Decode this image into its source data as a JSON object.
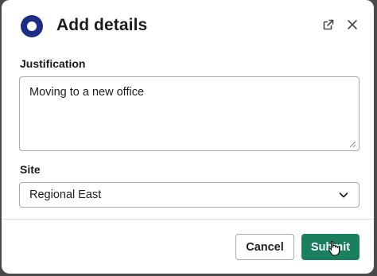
{
  "dialog": {
    "title": "Add details",
    "icons": {
      "app": "app-logo-icon",
      "popout": "external-link-icon",
      "close": "close-icon"
    }
  },
  "form": {
    "justification": {
      "label": "Justification",
      "value": "Moving to a new office"
    },
    "site": {
      "label": "Site",
      "selected": "Regional East"
    }
  },
  "footer": {
    "cancel_label": "Cancel",
    "submit_label": "Submit"
  },
  "colors": {
    "brand": "#1d2c86",
    "primary_button": "#1a7f5e"
  }
}
